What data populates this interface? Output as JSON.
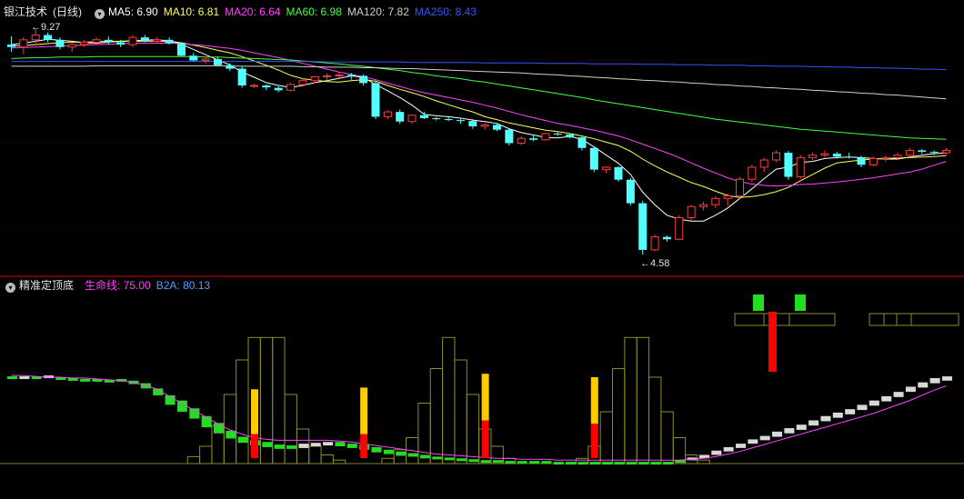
{
  "price_panel": {
    "stock_name": "银江技术",
    "period": "(日线)",
    "ma": [
      {
        "label": "MA5:",
        "value": "6.90",
        "color": "#ffffff"
      },
      {
        "label": "MA10:",
        "value": "6.81",
        "color": "#ffff55"
      },
      {
        "label": "MA20:",
        "value": "6.64",
        "color": "#ff44ff"
      },
      {
        "label": "MA60:",
        "value": "6.98",
        "color": "#44ff44"
      },
      {
        "label": "MA120:",
        "value": "7.82",
        "color": "#d0d0d0"
      },
      {
        "label": "MA250:",
        "value": "8.43",
        "color": "#3355ff"
      }
    ],
    "high_label": "9.27",
    "low_label": "4.58"
  },
  "indicator_panel": {
    "name": "精准定顶底",
    "lines": [
      {
        "label": "生命线:",
        "value": "75.00",
        "color": "#ff44ff"
      },
      {
        "label": "B2A:",
        "value": "80.13",
        "color": "#4fa0ff"
      }
    ]
  },
  "chart_data": [
    {
      "type": "candlestick",
      "title": "银江技术(日线)",
      "ylim": [
        4.3,
        9.5
      ],
      "ohlc": [
        [
          8.95,
          9.12,
          8.8,
          8.9
        ],
        [
          8.9,
          9.1,
          8.75,
          9.05
        ],
        [
          9.05,
          9.27,
          8.95,
          9.15
        ],
        [
          9.15,
          9.2,
          9.0,
          9.05
        ],
        [
          9.05,
          9.1,
          8.85,
          8.9
        ],
        [
          8.9,
          9.0,
          8.8,
          8.95
        ],
        [
          8.95,
          9.05,
          8.9,
          9.0
        ],
        [
          9.0,
          9.1,
          8.95,
          9.05
        ],
        [
          9.05,
          9.12,
          8.95,
          9.0
        ],
        [
          9.0,
          9.05,
          8.9,
          8.95
        ],
        [
          8.95,
          9.15,
          8.9,
          9.1
        ],
        [
          9.1,
          9.15,
          9.0,
          9.02
        ],
        [
          9.02,
          9.1,
          8.98,
          9.05
        ],
        [
          9.05,
          9.1,
          8.95,
          8.98
        ],
        [
          8.98,
          9.0,
          8.7,
          8.72
        ],
        [
          8.72,
          8.78,
          8.6,
          8.62
        ],
        [
          8.62,
          8.7,
          8.55,
          8.65
        ],
        [
          8.65,
          8.7,
          8.5,
          8.52
        ],
        [
          8.52,
          8.56,
          8.4,
          8.45
        ],
        [
          8.45,
          8.5,
          8.05,
          8.1
        ],
        [
          8.1,
          8.14,
          8.05,
          8.1
        ],
        [
          8.1,
          8.12,
          8.0,
          8.06
        ],
        [
          8.05,
          8.08,
          7.96,
          8.0
        ],
        [
          8.0,
          8.15,
          7.98,
          8.12
        ],
        [
          8.12,
          8.25,
          8.08,
          8.2
        ],
        [
          8.2,
          8.3,
          8.15,
          8.28
        ],
        [
          8.28,
          8.35,
          8.2,
          8.3
        ],
        [
          8.3,
          8.38,
          8.25,
          8.32
        ],
        [
          8.32,
          8.36,
          8.22,
          8.3
        ],
        [
          8.3,
          8.33,
          8.1,
          8.15
        ],
        [
          8.15,
          8.18,
          7.4,
          7.45
        ],
        [
          7.45,
          7.58,
          7.4,
          7.55
        ],
        [
          7.55,
          7.6,
          7.3,
          7.35
        ],
        [
          7.35,
          7.5,
          7.3,
          7.48
        ],
        [
          7.48,
          7.55,
          7.4,
          7.42
        ],
        [
          7.42,
          7.44,
          7.37,
          7.4
        ],
        [
          7.4,
          7.44,
          7.36,
          7.38
        ],
        [
          7.38,
          7.4,
          7.3,
          7.36
        ],
        [
          7.36,
          7.4,
          7.2,
          7.25
        ],
        [
          7.25,
          7.32,
          7.18,
          7.28
        ],
        [
          7.28,
          7.3,
          7.15,
          7.18
        ],
        [
          7.18,
          7.2,
          6.85,
          6.9
        ],
        [
          6.9,
          7.05,
          6.86,
          7.0
        ],
        [
          7.0,
          7.06,
          6.94,
          6.97
        ],
        [
          6.97,
          7.12,
          6.95,
          7.1
        ],
        [
          7.1,
          7.14,
          7.05,
          7.08
        ],
        [
          7.08,
          7.1,
          7.0,
          7.02
        ],
        [
          7.02,
          7.05,
          6.75,
          6.8
        ],
        [
          6.8,
          6.82,
          6.3,
          6.35
        ],
        [
          6.35,
          6.42,
          6.28,
          6.4
        ],
        [
          6.4,
          6.42,
          6.1,
          6.14
        ],
        [
          6.14,
          6.18,
          5.6,
          5.65
        ],
        [
          5.65,
          5.7,
          4.58,
          4.68
        ],
        [
          4.68,
          5.0,
          4.65,
          4.95
        ],
        [
          4.95,
          4.98,
          4.85,
          4.9
        ],
        [
          4.9,
          5.4,
          4.88,
          5.35
        ],
        [
          5.35,
          5.62,
          5.3,
          5.58
        ],
        [
          5.58,
          5.68,
          5.5,
          5.62
        ],
        [
          5.62,
          5.8,
          5.55,
          5.75
        ],
        [
          5.75,
          5.85,
          5.6,
          5.8
        ],
        [
          5.8,
          6.2,
          5.75,
          6.15
        ],
        [
          6.15,
          6.45,
          6.1,
          6.4
        ],
        [
          6.4,
          6.6,
          6.3,
          6.55
        ],
        [
          6.55,
          6.75,
          6.5,
          6.7
        ],
        [
          6.7,
          6.74,
          6.14,
          6.2
        ],
        [
          6.2,
          6.65,
          6.16,
          6.6
        ],
        [
          6.6,
          6.7,
          6.55,
          6.65
        ],
        [
          6.65,
          6.75,
          6.6,
          6.68
        ],
        [
          6.68,
          6.72,
          6.58,
          6.62
        ],
        [
          6.62,
          6.7,
          6.58,
          6.6
        ],
        [
          6.6,
          6.64,
          6.4,
          6.45
        ],
        [
          6.45,
          6.62,
          6.42,
          6.58
        ],
        [
          6.58,
          6.64,
          6.52,
          6.6
        ],
        [
          6.6,
          6.7,
          6.55,
          6.65
        ],
        [
          6.65,
          6.8,
          6.6,
          6.75
        ],
        [
          6.75,
          6.78,
          6.68,
          6.72
        ],
        [
          6.72,
          6.75,
          6.65,
          6.7
        ],
        [
          6.7,
          6.8,
          6.66,
          6.75
        ]
      ],
      "ma_lines": {
        "MA5": [
          8.95,
          8.98,
          9.02,
          9.06,
          9.04,
          9.02,
          8.99,
          8.98,
          9.0,
          9.02,
          9.03,
          9.04,
          9.05,
          9.03,
          8.96,
          8.85,
          8.74,
          8.63,
          8.53,
          8.38,
          8.27,
          8.16,
          8.1,
          8.06,
          8.1,
          8.16,
          8.2,
          8.25,
          8.3,
          8.27,
          8.12,
          7.99,
          7.85,
          7.69,
          7.5,
          7.47,
          7.45,
          7.42,
          7.38,
          7.35,
          7.31,
          7.2,
          7.12,
          7.07,
          7.02,
          7.01,
          7.04,
          6.98,
          6.82,
          6.65,
          6.48,
          6.25,
          5.88,
          5.62,
          5.4,
          5.32,
          5.28,
          5.28,
          5.4,
          5.55,
          5.75,
          5.95,
          6.16,
          6.36,
          6.4,
          6.5,
          6.52,
          6.58,
          6.6,
          6.61,
          6.6,
          6.58,
          6.57,
          6.57,
          6.61,
          6.65,
          6.68,
          6.7
        ],
        "MA10": [
          8.92,
          8.93,
          8.95,
          8.97,
          8.99,
          9.0,
          9.0,
          9.01,
          9.02,
          9.02,
          9.02,
          9.02,
          9.02,
          9.02,
          8.99,
          8.94,
          8.89,
          8.83,
          8.78,
          8.7,
          8.61,
          8.52,
          8.42,
          8.31,
          8.24,
          8.21,
          8.18,
          8.17,
          8.2,
          8.22,
          8.19,
          8.1,
          8.02,
          7.95,
          7.87,
          7.78,
          7.7,
          7.62,
          7.55,
          7.45,
          7.39,
          7.32,
          7.27,
          7.22,
          7.17,
          7.14,
          7.1,
          7.05,
          6.99,
          6.92,
          6.85,
          6.73,
          6.57,
          6.43,
          6.3,
          6.19,
          6.08,
          6.0,
          5.9,
          5.81,
          5.77,
          5.79,
          5.83,
          5.89,
          5.98,
          6.12,
          6.25,
          6.38,
          6.49,
          6.52,
          6.55,
          6.57,
          6.58,
          6.59,
          6.6,
          6.61,
          6.62,
          6.64
        ],
        "MA20": [
          8.88,
          8.89,
          8.9,
          8.91,
          8.92,
          8.93,
          8.94,
          8.95,
          8.96,
          8.97,
          8.98,
          8.98,
          8.98,
          8.98,
          8.97,
          8.95,
          8.93,
          8.9,
          8.87,
          8.83,
          8.78,
          8.73,
          8.68,
          8.62,
          8.56,
          8.5,
          8.44,
          8.38,
          8.33,
          8.28,
          8.22,
          8.15,
          8.08,
          8.01,
          7.95,
          7.9,
          7.85,
          7.8,
          7.75,
          7.69,
          7.63,
          7.56,
          7.49,
          7.43,
          7.37,
          7.31,
          7.27,
          7.22,
          7.17,
          7.11,
          7.05,
          6.97,
          6.88,
          6.79,
          6.7,
          6.6,
          6.49,
          6.38,
          6.28,
          6.18,
          6.1,
          6.05,
          6.02,
          6.01,
          6.02,
          6.04,
          6.05,
          6.07,
          6.09,
          6.12,
          6.15,
          6.18,
          6.22,
          6.26,
          6.3,
          6.36,
          6.44,
          6.52
        ],
        "MA60": [
          8.66,
          8.67,
          8.68,
          8.68,
          8.69,
          8.69,
          8.69,
          8.7,
          8.7,
          8.7,
          8.7,
          8.7,
          8.7,
          8.7,
          8.7,
          8.7,
          8.69,
          8.69,
          8.68,
          8.67,
          8.66,
          8.65,
          8.64,
          8.63,
          8.61,
          8.59,
          8.57,
          8.55,
          8.52,
          8.5,
          8.47,
          8.44,
          8.41,
          8.37,
          8.34,
          8.3,
          8.27,
          8.24,
          8.2,
          8.17,
          8.13,
          8.09,
          8.05,
          8.01,
          7.97,
          7.93,
          7.89,
          7.85,
          7.8,
          7.76,
          7.72,
          7.68,
          7.64,
          7.6,
          7.56,
          7.52,
          7.48,
          7.44,
          7.4,
          7.37,
          7.34,
          7.31,
          7.28,
          7.25,
          7.22,
          7.19,
          7.17,
          7.15,
          7.13,
          7.11,
          7.09,
          7.07,
          7.05,
          7.03,
          7.01,
          7.0,
          6.99,
          6.98
        ],
        "MA120": [
          8.5,
          8.5,
          8.5,
          8.5,
          8.5,
          8.5,
          8.5,
          8.51,
          8.51,
          8.51,
          8.51,
          8.51,
          8.51,
          8.51,
          8.51,
          8.51,
          8.51,
          8.51,
          8.51,
          8.5,
          8.5,
          8.5,
          8.5,
          8.5,
          8.49,
          8.49,
          8.48,
          8.48,
          8.48,
          8.47,
          8.47,
          8.46,
          8.45,
          8.45,
          8.44,
          8.43,
          8.42,
          8.41,
          8.4,
          8.39,
          8.38,
          8.37,
          8.36,
          8.34,
          8.33,
          8.32,
          8.3,
          8.29,
          8.27,
          8.26,
          8.24,
          8.23,
          8.21,
          8.2,
          8.18,
          8.17,
          8.15,
          8.14,
          8.12,
          8.11,
          8.09,
          8.08,
          8.06,
          8.05,
          8.03,
          8.02,
          8.0,
          7.99,
          7.97,
          7.96,
          7.94,
          7.93,
          7.91,
          7.9,
          7.88,
          7.86,
          7.84,
          7.82
        ],
        "MA250": [
          8.6,
          8.6,
          8.6,
          8.6,
          8.6,
          8.6,
          8.6,
          8.6,
          8.6,
          8.6,
          8.6,
          8.6,
          8.6,
          8.6,
          8.6,
          8.6,
          8.6,
          8.6,
          8.6,
          8.6,
          8.6,
          8.6,
          8.6,
          8.6,
          8.6,
          8.6,
          8.59,
          8.59,
          8.59,
          8.59,
          8.59,
          8.59,
          8.59,
          8.58,
          8.58,
          8.58,
          8.58,
          8.58,
          8.58,
          8.57,
          8.57,
          8.57,
          8.57,
          8.57,
          8.56,
          8.56,
          8.56,
          8.56,
          8.55,
          8.55,
          8.55,
          8.55,
          8.54,
          8.54,
          8.54,
          8.53,
          8.53,
          8.53,
          8.52,
          8.52,
          8.52,
          8.51,
          8.51,
          8.5,
          8.5,
          8.5,
          8.49,
          8.49,
          8.48,
          8.48,
          8.47,
          8.47,
          8.46,
          8.46,
          8.45,
          8.44,
          8.44,
          8.43
        ]
      }
    },
    {
      "type": "bar",
      "title": "精准定顶底",
      "ylim": [
        0,
        100
      ],
      "ribbon_open": [
        50.5,
        50.5,
        50.5,
        51.0,
        50.0,
        49.5,
        49.0,
        49.0,
        48.5,
        49.0,
        48.0,
        46.5,
        43.5,
        39.5,
        36.5,
        32.0,
        27.5,
        23.5,
        19.0,
        15.5,
        13.5,
        12.5,
        11.0,
        10.5,
        11.5,
        12.0,
        12.5,
        12.5,
        11.5,
        11.0,
        9.5,
        8.0,
        7.0,
        6.0,
        5.0,
        4.0,
        3.5,
        3.0,
        2.5,
        2.0,
        2.0,
        1.5,
        1.5,
        1.5,
        1.5,
        1.0,
        1.0,
        1.0,
        1.0,
        1.0,
        1.0,
        1.0,
        1.0,
        1.0,
        1.0,
        2.0,
        3.5,
        5.0,
        7.5,
        9.5,
        11.5,
        14.0,
        16.0,
        18.5,
        20.5,
        22.5,
        25.0,
        27.5,
        29.5,
        31.5,
        34.0,
        36.5,
        39.0,
        41.5,
        44.5,
        47.0,
        49.5,
        50.5
      ],
      "ribbon_close": [
        49.0,
        49.5,
        49.0,
        49.5,
        49.0,
        49.0,
        48.5,
        48.0,
        48.0,
        47.5,
        46.0,
        43.5,
        39.5,
        34.0,
        30.0,
        26.0,
        21.0,
        17.5,
        14.5,
        12.0,
        10.5,
        9.5,
        8.5,
        8.5,
        9.0,
        10.0,
        10.5,
        10.0,
        9.0,
        8.0,
        6.5,
        5.5,
        4.5,
        4.0,
        3.0,
        2.5,
        2.0,
        1.5,
        1.5,
        1.0,
        1.0,
        0.5,
        0.5,
        0.5,
        0.5,
        0.5,
        0.5,
        0.5,
        0.5,
        0.5,
        0.5,
        0.5,
        0.5,
        0.5,
        0.5,
        1.0,
        2.0,
        3.0,
        5.0,
        7.0,
        9.0,
        11.5,
        13.5,
        15.5,
        17.5,
        19.5,
        22.0,
        24.5,
        26.5,
        28.5,
        31.0,
        33.5,
        36.0,
        38.5,
        41.5,
        44.0,
        46.5,
        48.0
      ],
      "life_line": [
        51.0,
        51.0,
        50.5,
        50.0,
        50.0,
        49.5,
        49.5,
        49.0,
        48.5,
        48.0,
        47.0,
        45.5,
        43.0,
        39.0,
        35.0,
        31.0,
        27.0,
        23.0,
        19.5,
        17.0,
        15.0,
        14.0,
        13.5,
        13.5,
        13.5,
        13.5,
        13.5,
        13.0,
        12.5,
        11.5,
        10.5,
        9.5,
        8.5,
        7.5,
        6.5,
        5.5,
        5.0,
        4.5,
        4.0,
        3.5,
        3.0,
        3.0,
        2.5,
        2.5,
        2.5,
        2.0,
        2.0,
        2.0,
        2.0,
        2.0,
        2.0,
        2.0,
        2.0,
        2.0,
        2.0,
        2.0,
        2.5,
        3.0,
        4.0,
        5.5,
        7.0,
        9.0,
        11.0,
        13.0,
        15.0,
        17.0,
        19.0,
        21.0,
        23.0,
        25.0,
        27.0,
        29.0,
        31.5,
        34.0,
        36.5,
        39.5,
        42.5,
        45.0
      ],
      "volume": [
        0,
        0,
        0,
        0,
        0,
        0,
        0,
        0,
        0,
        0,
        0,
        0,
        0,
        0,
        0,
        4,
        10,
        22,
        40,
        60,
        73,
        73,
        73,
        40,
        20,
        10,
        5,
        2,
        0,
        0,
        0,
        3,
        8,
        15,
        35,
        55,
        73,
        60,
        40,
        20,
        10,
        3,
        0,
        0,
        0,
        0,
        0,
        3,
        10,
        30,
        55,
        73,
        73,
        50,
        30,
        15,
        5,
        2,
        0,
        0,
        0,
        0,
        0,
        0,
        0,
        0,
        0,
        0,
        0,
        0,
        0,
        0,
        0,
        0,
        0,
        0,
        0,
        0
      ],
      "signals": [
        {
          "index": 20,
          "yellow": 26,
          "red": 17
        },
        {
          "index": 29,
          "yellow": 27,
          "red": 17
        },
        {
          "index": 39,
          "yellow": 27,
          "red": 25
        },
        {
          "index": 48,
          "yellow": 27,
          "red": 23
        }
      ]
    }
  ]
}
